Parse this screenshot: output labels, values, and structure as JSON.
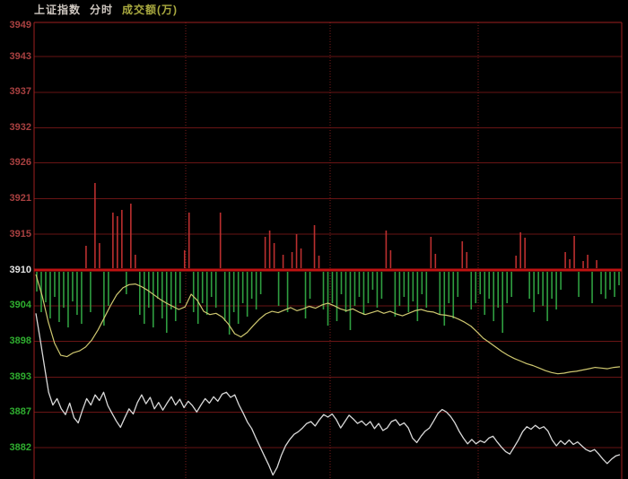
{
  "header": {
    "index_name": "上证指数",
    "mode_label": "分时",
    "volume_label": "成交额(万)"
  },
  "colors": {
    "background": "#000000",
    "frame": "#9e2121",
    "grid": "#691515",
    "dotted_grid": "#7d1d1d",
    "prev_close_line": "#c01212",
    "bar_up": "#bb2f2f",
    "bar_down": "#2f9e40",
    "price_line": "#d9d9d9",
    "avg_line": "#cfc870",
    "label_up": "#a84040",
    "label_flat": "#e3e3e3",
    "label_down": "#2fae2f"
  },
  "chart_data": {
    "type": "line",
    "title": "上证指数 分时 (intraday)",
    "xlabel": "",
    "ylabel": "",
    "prev_close": 3910,
    "ylim": [
      3877.5,
      3949.4
    ],
    "grid": true,
    "legend_position": "none",
    "y_ticks": [
      {
        "label": "3949",
        "price": 3949.1,
        "zone": "up"
      },
      {
        "label": "3943",
        "price": 3943.5,
        "zone": "up"
      },
      {
        "label": "3937",
        "price": 3937.9,
        "zone": "up"
      },
      {
        "label": "3932",
        "price": 3932.3,
        "zone": "up"
      },
      {
        "label": "3926",
        "price": 3926.8,
        "zone": "up"
      },
      {
        "label": "3921",
        "price": 3921.2,
        "zone": "up"
      },
      {
        "label": "3915",
        "price": 3915.6,
        "zone": "up"
      },
      {
        "label": "3910",
        "price": 3910.0,
        "zone": "flat"
      },
      {
        "label": "3904",
        "price": 3904.4,
        "zone": "down"
      },
      {
        "label": "3898",
        "price": 3898.8,
        "zone": "down"
      },
      {
        "label": "3893",
        "price": 3893.2,
        "zone": "down"
      },
      {
        "label": "3887",
        "price": 3887.7,
        "zone": "down"
      },
      {
        "label": "3882",
        "price": 3882.1,
        "zone": "down"
      }
    ],
    "x_dotted_gridline_fracs": [
      0.258,
      0.504,
      0.756
    ],
    "series": [
      {
        "name": "price",
        "color": "#d9d9d9",
        "values": [
          3903.2,
          3899.2,
          3895.0,
          3890.8,
          3888.8,
          3889.8,
          3888.2,
          3887.3,
          3889.1,
          3886.8,
          3886.0,
          3888.0,
          3889.8,
          3888.8,
          3890.4,
          3889.5,
          3890.8,
          3888.7,
          3887.5,
          3886.3,
          3885.3,
          3886.8,
          3888.2,
          3887.4,
          3889.2,
          3890.4,
          3889.0,
          3890.0,
          3888.2,
          3889.2,
          3888.0,
          3889.1,
          3890.1,
          3888.8,
          3889.7,
          3888.4,
          3889.4,
          3888.7,
          3887.7,
          3888.8,
          3889.8,
          3889.1,
          3890.1,
          3889.4,
          3890.5,
          3890.8,
          3890.0,
          3890.4,
          3888.8,
          3887.5,
          3886.1,
          3885.1,
          3883.6,
          3882.2,
          3880.8,
          3879.4,
          3877.8,
          3879.0,
          3880.9,
          3882.4,
          3883.4,
          3884.2,
          3884.6,
          3885.2,
          3885.9,
          3886.2,
          3885.5,
          3886.5,
          3887.3,
          3886.9,
          3887.4,
          3886.5,
          3885.2,
          3886.2,
          3887.2,
          3886.6,
          3885.9,
          3886.3,
          3885.6,
          3886.2,
          3885.1,
          3885.9,
          3884.8,
          3885.2,
          3886.2,
          3886.5,
          3885.6,
          3886.0,
          3885.2,
          3883.6,
          3882.9,
          3883.9,
          3884.7,
          3885.2,
          3886.3,
          3887.5,
          3888.1,
          3887.7,
          3887.0,
          3886.0,
          3884.7,
          3883.6,
          3882.7,
          3883.4,
          3882.7,
          3883.2,
          3882.9,
          3883.6,
          3883.9,
          3883.0,
          3882.2,
          3881.5,
          3881.1,
          3882.2,
          3883.3,
          3884.6,
          3885.4,
          3885.0,
          3885.6,
          3885.1,
          3885.4,
          3884.7,
          3883.3,
          3882.4,
          3883.2,
          3882.6,
          3883.3,
          3882.6,
          3883.0,
          3882.4,
          3881.8,
          3881.5,
          3881.8,
          3881.1,
          3880.3,
          3879.6,
          3880.3,
          3880.8,
          3881.0
        ]
      },
      {
        "name": "average_price",
        "color": "#cfc870",
        "values": [
          3909.3,
          3906.0,
          3901.8,
          3898.5,
          3896.6,
          3896.4,
          3897.0,
          3897.3,
          3897.9,
          3899.0,
          3900.6,
          3902.5,
          3904.4,
          3906.1,
          3907.2,
          3907.7,
          3907.8,
          3907.4,
          3906.8,
          3906.1,
          3905.4,
          3904.8,
          3904.3,
          3903.8,
          3904.2,
          3906.2,
          3905.2,
          3903.5,
          3903.0,
          3903.2,
          3902.6,
          3901.5,
          3900.0,
          3899.5,
          3900.2,
          3901.3,
          3902.3,
          3903.1,
          3903.5,
          3903.3,
          3903.7,
          3904.1,
          3903.6,
          3903.9,
          3904.3,
          3904.0,
          3904.5,
          3904.8,
          3904.4,
          3903.9,
          3903.6,
          3903.9,
          3903.4,
          3903.0,
          3903.3,
          3903.6,
          3903.2,
          3903.5,
          3903.1,
          3902.8,
          3903.2,
          3903.6,
          3903.8,
          3903.5,
          3903.4,
          3903.0,
          3902.9,
          3902.7,
          3902.3,
          3901.8,
          3901.2,
          3900.3,
          3899.3,
          3898.6,
          3897.9,
          3897.2,
          3896.6,
          3896.1,
          3895.7,
          3895.3,
          3895.0,
          3894.6,
          3894.2,
          3893.9,
          3893.7,
          3893.8,
          3894.0,
          3894.1,
          3894.3,
          3894.5,
          3894.7,
          3894.6,
          3894.5,
          3894.7,
          3894.8
        ]
      }
    ],
    "volume_bars": {
      "note": "relative turnover per interval; positive = up tick (red, above prev-close line), negative = down tick (green, below line)",
      "values": [
        -22,
        -45,
        -34,
        -52,
        -28,
        -56,
        -40,
        -62,
        -33,
        -48,
        -58,
        25,
        -45,
        95,
        28,
        -60,
        -38,
        62,
        58,
        65,
        -25,
        72,
        15,
        -48,
        -58,
        -40,
        -62,
        -30,
        -52,
        -68,
        -42,
        -55,
        -35,
        20,
        62,
        -45,
        -58,
        -35,
        -48,
        -28,
        -40,
        62,
        -55,
        -70,
        -45,
        -58,
        -35,
        -50,
        -30,
        -42,
        -25,
        35,
        42,
        28,
        -38,
        15,
        -45,
        18,
        38,
        22,
        -52,
        -30,
        48,
        14,
        -42,
        -60,
        -35,
        -55,
        -25,
        -45,
        -65,
        -38,
        -28,
        -48,
        -35,
        -20,
        -40,
        -30,
        42,
        20,
        -50,
        -38,
        -28,
        -45,
        -33,
        -55,
        -25,
        -40,
        35,
        16,
        -48,
        -60,
        -35,
        -52,
        -28,
        30,
        18,
        -42,
        -35,
        -25,
        -48,
        -30,
        -55,
        -40,
        -68,
        -35,
        -28,
        14,
        40,
        34,
        -30,
        -45,
        -25,
        -38,
        -55,
        -30,
        -42,
        -20,
        18,
        10,
        36,
        -28,
        8,
        15,
        -35,
        9,
        -25,
        -30,
        -20,
        -28,
        -15
      ]
    }
  }
}
